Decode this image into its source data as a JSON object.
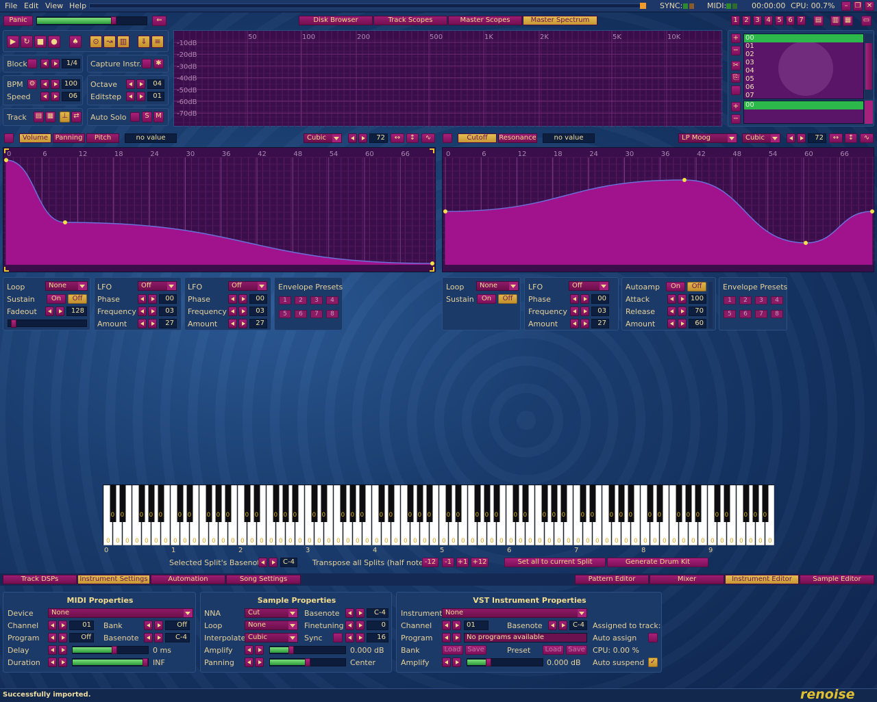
{
  "menu": [
    "File",
    "Edit",
    "View",
    "Help"
  ],
  "top_status": {
    "sync": "SYNC:",
    "midi": "MIDI:",
    "time": "00:00:00",
    "cpu": "CPU: 00.7%"
  },
  "toolbar": {
    "panic": "Panic",
    "tabs": [
      "Disk Browser",
      "Track Scopes",
      "Master Scopes",
      "Master Spectrum"
    ],
    "active_tab": "Master Spectrum",
    "track_nums": [
      "1",
      "2",
      "3",
      "4",
      "5",
      "6",
      "7"
    ]
  },
  "transport": {
    "block_label": "Block",
    "block_value": "1/4",
    "capture": "Capture Instr.",
    "bpm_label": "BPM",
    "bpm": "100",
    "speed_label": "Speed",
    "speed": "06",
    "octave_label": "Octave",
    "octave": "04",
    "editstep_label": "Editstep",
    "editstep": "01",
    "track_label": "Track",
    "autosolo": "Auto Solo"
  },
  "spectrum": {
    "x_ticks": [
      "50",
      "100",
      "200",
      "500",
      "1K",
      "2K",
      "5K",
      "10K"
    ],
    "y_ticks": [
      "-10dB",
      "-20dB",
      "-30dB",
      "-40dB",
      "-50dB",
      "-60dB",
      "-70dB"
    ]
  },
  "instrument_list": [
    "00",
    "01",
    "02",
    "03",
    "04",
    "05",
    "06",
    "07"
  ],
  "sample_list": [
    "00"
  ],
  "env_left": {
    "tabs": [
      "Volume",
      "Panning",
      "Pitch"
    ],
    "active": "Volume",
    "novalue": "no value",
    "interp": "Cubic",
    "length": "72",
    "x_ticks": [
      "0",
      "6",
      "12",
      "18",
      "24",
      "30",
      "36",
      "42",
      "48",
      "54",
      "60",
      "66"
    ]
  },
  "env_right": {
    "tabs": [
      "Cutoff",
      "Resonance"
    ],
    "active": "Cutoff",
    "novalue": "no value",
    "filter": "LP Moog",
    "interp": "Cubic",
    "length": "72",
    "x_ticks": [
      "0",
      "6",
      "12",
      "18",
      "24",
      "30",
      "36",
      "42",
      "48",
      "54",
      "60",
      "66"
    ]
  },
  "left_controls": {
    "loop_label": "Loop",
    "loop": "None",
    "sustain_label": "Sustain",
    "on": "On",
    "off": "Off",
    "fadeout_label": "Fadeout",
    "fadeout": "128",
    "lfo1": {
      "label": "LFO",
      "value": "Off",
      "phase_label": "Phase",
      "phase": "00",
      "freq_label": "Frequency",
      "freq": "03",
      "amount_label": "Amount",
      "amount": "27"
    },
    "lfo2": {
      "label": "LFO",
      "value": "Off",
      "phase_label": "Phase",
      "phase": "00",
      "freq_label": "Frequency",
      "freq": "03",
      "amount_label": "Amount",
      "amount": "27"
    },
    "presets_label": "Envelope Presets",
    "presets": [
      "1",
      "2",
      "3",
      "4",
      "5",
      "6",
      "7",
      "8"
    ]
  },
  "right_controls": {
    "loop_label": "Loop",
    "loop": "None",
    "sustain_label": "Sustain",
    "on": "On",
    "off": "Off",
    "lfo": {
      "label": "LFO",
      "value": "Off",
      "phase_label": "Phase",
      "phase": "00",
      "freq_label": "Frequency",
      "freq": "03",
      "amount_label": "Amount",
      "amount": "27"
    },
    "autoamp_label": "Autoamp",
    "autoamp_on": "On",
    "autoamp_off": "Off",
    "attack_label": "Attack",
    "attack": "100",
    "release_label": "Release",
    "release": "70",
    "amount_label": "Amount",
    "amount": "60",
    "presets_label": "Envelope Presets",
    "presets": [
      "1",
      "2",
      "3",
      "4",
      "5",
      "6",
      "7",
      "8"
    ]
  },
  "keyboard": {
    "octaves": [
      "0",
      "1",
      "2",
      "3",
      "4",
      "5",
      "6",
      "7",
      "8",
      "9"
    ],
    "basenote_label": "Selected Split's Basenote",
    "basenote": "C-4",
    "transpose_label": "Transpose all Splits (half notes)",
    "transpose_btns": [
      "-12",
      "-1",
      "+1",
      "+12"
    ],
    "set_all": "Set all to current Split",
    "gen_drum": "Generate Drum Kit",
    "key_mark": "0"
  },
  "lower_tabs": {
    "left": [
      "Track DSPs",
      "Instrument Settings",
      "Automation",
      "Song Settings"
    ],
    "left_active": "Instrument Settings",
    "right": [
      "Pattern Editor",
      "Mixer",
      "Instrument Editor",
      "Sample Editor"
    ],
    "right_active": "Instrument Editor"
  },
  "midi": {
    "title": "MIDI Properties",
    "device_label": "Device",
    "device": "None",
    "channel_label": "Channel",
    "channel": "01",
    "bank_label": "Bank",
    "bank": "Off",
    "program_label": "Program",
    "program": "Off",
    "basenote_label": "Basenote",
    "basenote": "C-4",
    "delay_label": "Delay",
    "delay": "0 ms",
    "delay_level": 0.55,
    "duration_label": "Duration",
    "duration": "INF",
    "duration_level": 1.0
  },
  "sample": {
    "title": "Sample Properties",
    "nna_label": "NNA",
    "nna": "Cut",
    "basenote_label": "Basenote",
    "basenote": "C-4",
    "loop_label": "Loop",
    "loop": "None",
    "finetune_label": "Finetuning",
    "finetune": "0",
    "interp_label": "Interpolate",
    "interp": "Cubic",
    "sync_label": "Sync",
    "sync": "16",
    "amplify_label": "Amplify",
    "amplify": "0.000 dB",
    "amplify_level": 0.28,
    "panning_label": "Panning",
    "panning": "Center",
    "panning_level": 0.5
  },
  "vst": {
    "title": "VST Instrument Properties",
    "instrument_label": "Instrument",
    "instrument": "None",
    "channel_label": "Channel",
    "channel": "01",
    "basenote_label": "Basenote",
    "basenote": "C-4",
    "program_label": "Program",
    "program": "No programs available",
    "bank_label": "Bank",
    "load": "Load",
    "save": "Save",
    "preset_label": "Preset",
    "amplify_label": "Amplify",
    "amplify": "0.000 dB",
    "amplify_level": 0.28,
    "assigned_label": "Assigned to track:",
    "auto_assign": "Auto assign",
    "cpu": "CPU: 0.00 %",
    "auto_suspend": "Auto suspend"
  },
  "status_text": "Successfully imported.",
  "logo": "renoise"
}
